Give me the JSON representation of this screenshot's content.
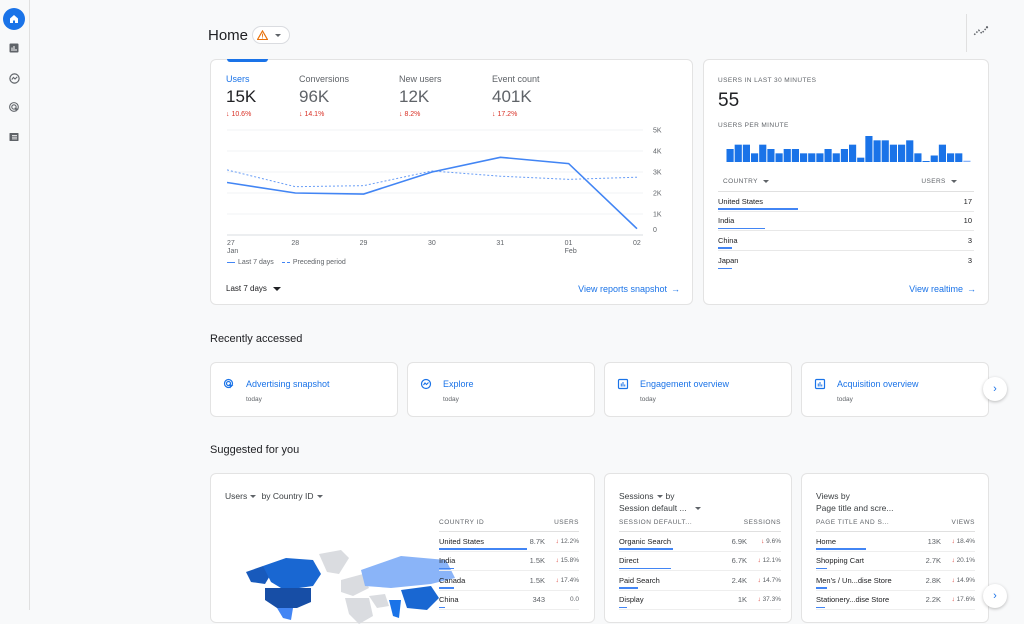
{
  "sidebar": {
    "items": [
      {
        "name": "home",
        "icon": "home-icon",
        "active": true
      },
      {
        "name": "reports",
        "icon": "bar-chart-icon",
        "active": false
      },
      {
        "name": "explore",
        "icon": "explore-icon",
        "active": false
      },
      {
        "name": "advertising",
        "icon": "advertising-icon",
        "active": false
      },
      {
        "name": "configure",
        "icon": "list-icon",
        "active": false
      }
    ]
  },
  "header": {
    "title": "Home",
    "warning_icon": "warning-icon",
    "insights_icon": "insights-icon"
  },
  "metrics_card": {
    "tabs": [
      {
        "label": "Users",
        "value": "15K",
        "delta": "10.6%",
        "direction": "down",
        "active": true
      },
      {
        "label": "Conversions",
        "value": "96K",
        "delta": "14.1%",
        "direction": "down",
        "active": false
      },
      {
        "label": "New users",
        "value": "12K",
        "delta": "8.2%",
        "direction": "down",
        "active": false
      },
      {
        "label": "Event count",
        "value": "401K",
        "delta": "17.2%",
        "direction": "down",
        "active": false
      }
    ],
    "legend": {
      "current": "Last 7 days",
      "previous": "Preceding period"
    },
    "range_label": "Last 7 days",
    "link_label": "View reports snapshot"
  },
  "chart_data": {
    "type": "line",
    "title": "Users",
    "x": [
      "27",
      "28",
      "29",
      "30",
      "31",
      "01",
      "02"
    ],
    "x_sublabels": [
      "Jan",
      "",
      "",
      "",
      "",
      "Feb",
      ""
    ],
    "series": [
      {
        "name": "Last 7 days",
        "style": "solid",
        "values": [
          2500,
          2000,
          1950,
          3000,
          3700,
          3400,
          300
        ]
      },
      {
        "name": "Preceding period",
        "style": "dashed",
        "values": [
          3100,
          2300,
          2350,
          3050,
          2800,
          2650,
          2750
        ]
      }
    ],
    "yticks": [
      "0",
      "1K",
      "2K",
      "3K",
      "4K",
      "5K"
    ],
    "ylim": [
      0,
      5000
    ],
    "grid": true,
    "legend_position": "bottom-left",
    "color": "#4285f4"
  },
  "realtime_card": {
    "title": "USERS IN LAST 30 MINUTES",
    "value": "55",
    "per_minute_label": "USERS PER MINUTE",
    "per_minute_values": [
      3,
      4,
      4,
      2,
      4,
      3,
      2,
      3,
      3,
      2,
      2,
      2,
      3,
      2,
      3,
      4,
      1,
      6,
      5,
      5,
      4,
      4,
      5,
      2,
      0.2,
      1.5,
      4,
      2,
      2,
      0.3
    ],
    "table": {
      "col_country": "COUNTRY",
      "col_users": "USERS",
      "rows": [
        {
          "country": "United States",
          "users": "17",
          "share": 1.0
        },
        {
          "country": "India",
          "users": "10",
          "share": 0.59
        },
        {
          "country": "China",
          "users": "3",
          "share": 0.18
        },
        {
          "country": "Japan",
          "users": "3",
          "share": 0.18
        }
      ]
    },
    "link_label": "View realtime"
  },
  "recently_accessed": {
    "title": "Recently accessed",
    "items": [
      {
        "label": "Advertising snapshot",
        "sub": "today",
        "icon": "advertising-icon"
      },
      {
        "label": "Explore",
        "sub": "today",
        "icon": "explore-icon"
      },
      {
        "label": "Engagement overview",
        "sub": "today",
        "icon": "bar-chart-icon"
      },
      {
        "label": "Acquisition overview",
        "sub": "today",
        "icon": "bar-chart-icon"
      }
    ]
  },
  "suggested": {
    "title": "Suggested for you",
    "country_card": {
      "metric": "Users",
      "by": "by Country ID",
      "col_dim": "COUNTRY ID",
      "col_metric": "USERS",
      "rows": [
        {
          "name": "United States",
          "value": "8.7K",
          "change": "12.2%",
          "direction": "down",
          "share": 1.0
        },
        {
          "name": "India",
          "value": "1.5K",
          "change": "15.8%",
          "direction": "down",
          "share": 0.17
        },
        {
          "name": "Canada",
          "value": "1.5K",
          "change": "17.4%",
          "direction": "down",
          "share": 0.17
        },
        {
          "name": "China",
          "value": "343",
          "change": "0.0",
          "direction": "none",
          "share": 0.04
        }
      ]
    },
    "sessions_card": {
      "title_line1": "Sessions",
      "title_by": "by",
      "title_line2": "Session default ...",
      "col_dim": "SESSION DEFAULT...",
      "col_metric": "SESSIONS",
      "rows": [
        {
          "name": "Organic Search",
          "value": "6.9K",
          "change": "9.6%",
          "direction": "down",
          "share": 1.0
        },
        {
          "name": "Direct",
          "value": "6.7K",
          "change": "12.1%",
          "direction": "down",
          "share": 0.97
        },
        {
          "name": "Paid Search",
          "value": "2.4K",
          "change": "14.7%",
          "direction": "down",
          "share": 0.35
        },
        {
          "name": "Display",
          "value": "1K",
          "change": "37.3%",
          "direction": "down",
          "share": 0.14
        }
      ]
    },
    "views_card": {
      "title_line1": "Views by",
      "title_line2": "Page title and scre...",
      "col_dim": "PAGE TITLE AND S...",
      "col_metric": "VIEWS",
      "rows": [
        {
          "name": "Home",
          "value": "13K",
          "change": "18.4%",
          "direction": "down",
          "share": 1.0
        },
        {
          "name": "Shopping Cart",
          "value": "2.7K",
          "change": "20.1%",
          "direction": "down",
          "share": 0.21
        },
        {
          "name": "Men's / Un...dise Store",
          "value": "2.8K",
          "change": "14.9%",
          "direction": "down",
          "share": 0.22
        },
        {
          "name": "Stationery...dise Store",
          "value": "2.2K",
          "change": "17.6%",
          "direction": "down",
          "share": 0.17
        }
      ]
    }
  },
  "colors": {
    "accent": "#1a73e8",
    "chart": "#4285f4",
    "negative": "#d93025"
  }
}
